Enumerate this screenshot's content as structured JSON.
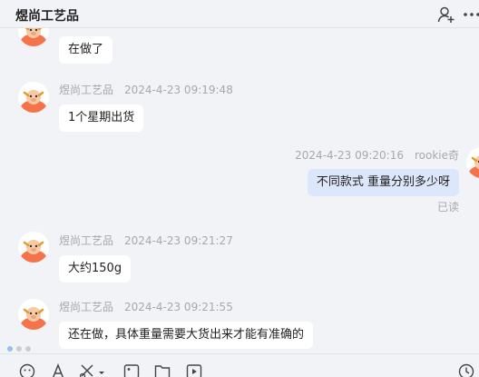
{
  "header": {
    "title": "煜尚工艺品"
  },
  "messages": [
    {
      "sender": "",
      "time": "",
      "text": "在做了"
    },
    {
      "sender": "煜尚工艺品",
      "time": "2024-4-23 09:19:48",
      "text": "1个星期出货"
    },
    {
      "sender": "rookie奇",
      "time": "2024-4-23 09:20:16",
      "text": "不同款式   重量分别多少呀",
      "status": "已读"
    },
    {
      "sender": "煜尚工艺品",
      "time": "2024-4-23 09:21:27",
      "text": "大约150g"
    },
    {
      "sender": "煜尚工艺品",
      "time": "2024-4-23 09:21:55",
      "text": "还在做，具体重量需要大货出来才能有准确的"
    }
  ],
  "icons": {
    "add_contact": "add-user-icon",
    "more": "more-icon",
    "emoji": "emoji-icon",
    "font": "font-icon",
    "screenshot": "scissors-icon",
    "image": "image-icon",
    "file": "folder-icon",
    "video": "video-icon",
    "history": "history-icon"
  },
  "colors": {
    "background": "#f2f3f7",
    "bubble_other": "#ffffff",
    "bubble_me": "#dde7fb",
    "meta_text": "#a6a8ae",
    "avatar_orange": "#f5734a"
  }
}
